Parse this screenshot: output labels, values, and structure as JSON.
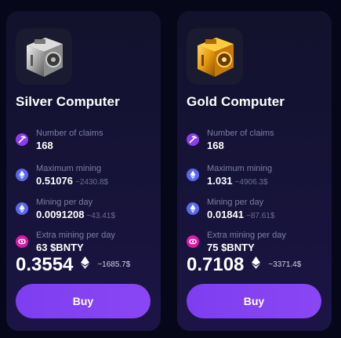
{
  "cards": [
    {
      "name": "Silver Computer",
      "image_icon": "silver-computer-icon",
      "claims_label": "Number of claims",
      "claims_value": "168",
      "max_label": "Maximum mining",
      "max_value": "0.51076",
      "max_usd": "~2430.8$",
      "per_day_label": "Mining per day",
      "per_day_value": "0.0091208",
      "per_day_usd": "~43.41$",
      "extra_label": "Extra mining per day",
      "extra_value": "63 $BNTY",
      "price": "0.3554",
      "price_usd": "~1685.7$",
      "buy_label": "Buy"
    },
    {
      "name": "Gold Computer",
      "image_icon": "gold-computer-icon",
      "claims_label": "Number of claims",
      "claims_value": "168",
      "max_label": "Maximum mining",
      "max_value": "1.031",
      "max_usd": "~4906.3$",
      "per_day_label": "Mining per day",
      "per_day_value": "0.01841",
      "per_day_usd": "~87.61$",
      "extra_label": "Extra mining per day",
      "extra_value": "75 $BNTY",
      "price": "0.7108",
      "price_usd": "~3371.4$",
      "buy_label": "Buy"
    }
  ],
  "colors": {
    "background": "#07071a",
    "card": "#15133a",
    "accent": "#8144f2",
    "pickaxe_icon": "#8c3cf0",
    "eth_icon": "#5a68f0",
    "bnty_icon": "#e01aa8"
  },
  "icons": [
    "pickaxe-icon",
    "eth-icon",
    "bnty-icon"
  ]
}
